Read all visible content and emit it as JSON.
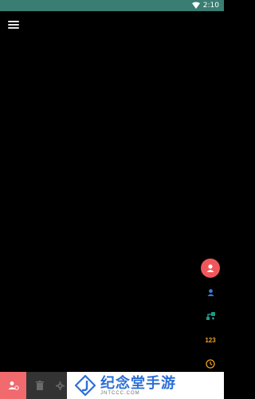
{
  "status_bar": {
    "time": "2:10",
    "icons": [
      "wifi-icon",
      "battery-icon"
    ]
  },
  "toolbar": {
    "menu_icon": "hamburger-icon"
  },
  "side_tools": [
    {
      "name": "person-tool",
      "icon": "person-icon",
      "active": true
    },
    {
      "name": "person-small-tool",
      "icon": "person-icon",
      "active": false
    },
    {
      "name": "add-branch-tool",
      "icon": "branch-icon",
      "active": false
    },
    {
      "name": "number-tool",
      "label": "123",
      "active": false
    },
    {
      "name": "clock-tool",
      "icon": "clock-icon",
      "active": false
    }
  ],
  "bottom_bar": {
    "items": [
      "user-settings-icon",
      "trash-icon",
      "gear-icon"
    ]
  },
  "watermark": {
    "title": "纪念堂手游",
    "url": "JNTCCC.COM"
  },
  "colors": {
    "status_bar": "#3a7d72",
    "accent_red": "#f0575b",
    "person_blue": "#3f7bd6",
    "branch_teal": "#1d9a8a",
    "number_orange": "#f0a020",
    "watermark_blue": "#2c6fd6"
  }
}
